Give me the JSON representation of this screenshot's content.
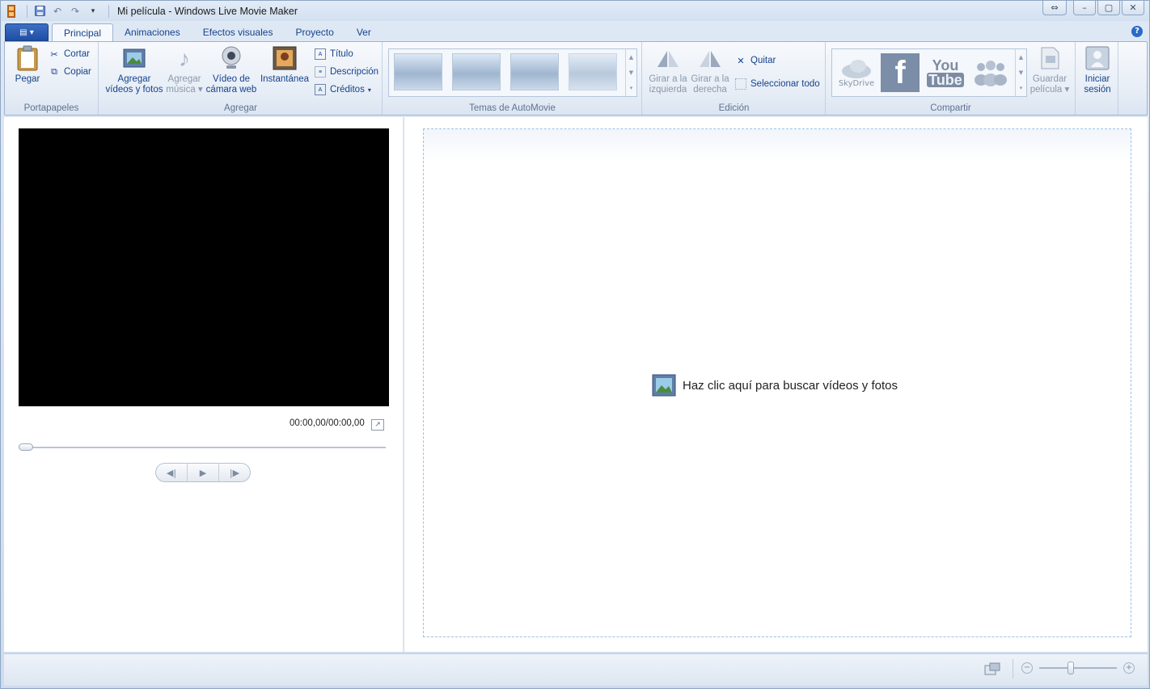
{
  "window": {
    "title": "Mi película - Windows Live Movie Maker"
  },
  "tabs": [
    {
      "label": "Principal",
      "active": true
    },
    {
      "label": "Animaciones"
    },
    {
      "label": "Efectos visuales"
    },
    {
      "label": "Proyecto"
    },
    {
      "label": "Ver"
    }
  ],
  "ribbon": {
    "portapapeles": {
      "label": "Portapapeles",
      "paste": "Pegar",
      "cut": "Cortar",
      "copy": "Copiar"
    },
    "agregar": {
      "label": "Agregar",
      "add_videos_line1": "Agregar",
      "add_videos_line2": "vídeos y fotos",
      "add_music_line1": "Agregar",
      "add_music_line2": "música",
      "webcam_line1": "Vídeo de",
      "webcam_line2": "cámara web",
      "snapshot": "Instantánea",
      "title": "Título",
      "caption": "Descripción",
      "credits": "Créditos"
    },
    "automovie": {
      "label": "Temas de AutoMovie"
    },
    "edicion": {
      "label": "Edición",
      "rotate_left_line1": "Girar a la",
      "rotate_left_line2": "izquierda",
      "rotate_right_line1": "Girar a la",
      "rotate_right_line2": "derecha",
      "remove": "Quitar",
      "select_all": "Seleccionar todo"
    },
    "compartir": {
      "label": "Compartir",
      "skydrive": "SkyDrive",
      "youtube_top": "You",
      "youtube_bottom": "Tube",
      "save_line1": "Guardar",
      "save_line2": "película",
      "signin_line1": "Iniciar",
      "signin_line2": "sesión"
    }
  },
  "preview": {
    "timecode": "00:00,00/00:00,00",
    "seek_position": 0
  },
  "storyboard": {
    "hint": "Haz clic aquí para buscar vídeos y fotos"
  },
  "status": {
    "zoom_level": 0.4
  },
  "colors": {
    "accent": "#1d4ea4",
    "ribbon_text": "#15428b",
    "storyboard_border": "#9cc1ea"
  }
}
